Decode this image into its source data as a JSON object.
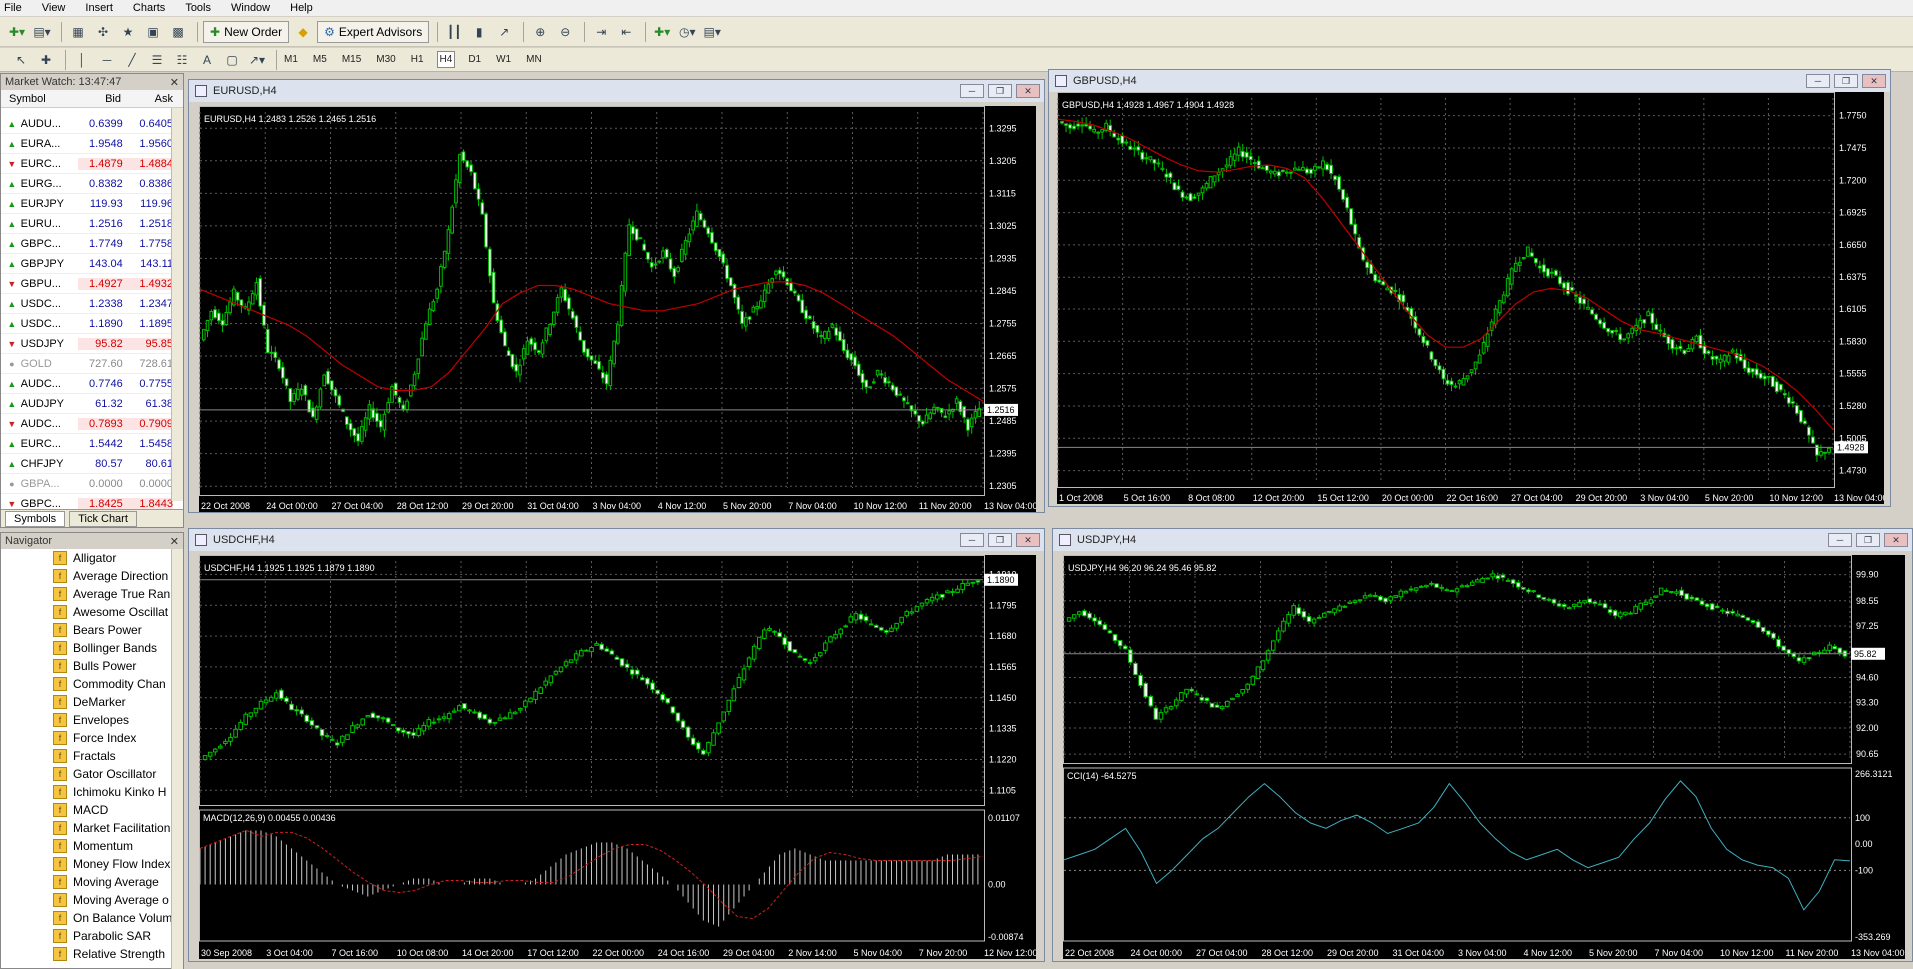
{
  "menu": [
    "File",
    "View",
    "Insert",
    "Charts",
    "Tools",
    "Window",
    "Help"
  ],
  "toolbar": {
    "new_order": "New Order",
    "expert_advisors": "Expert Advisors"
  },
  "timeframes": [
    "M1",
    "M5",
    "M15",
    "M30",
    "H1",
    "H4",
    "D1",
    "W1",
    "MN"
  ],
  "active_timeframe": "H4",
  "market_watch": {
    "title": "Market Watch: 13:47:47",
    "col_symbol": "Symbol",
    "col_bid": "Bid",
    "col_ask": "Ask",
    "rows": [
      {
        "sym": "AUDU...",
        "bid": "0.6399",
        "ask": "0.6405",
        "dir": "up"
      },
      {
        "sym": "EURA...",
        "bid": "1.9548",
        "ask": "1.9560",
        "dir": "up"
      },
      {
        "sym": "EURC...",
        "bid": "1.4879",
        "ask": "1.4884",
        "dir": "down"
      },
      {
        "sym": "EURG...",
        "bid": "0.8382",
        "ask": "0.8386",
        "dir": "up"
      },
      {
        "sym": "EURJPY",
        "bid": "119.93",
        "ask": "119.96",
        "dir": "up"
      },
      {
        "sym": "EURU...",
        "bid": "1.2516",
        "ask": "1.2518",
        "dir": "up"
      },
      {
        "sym": "GBPC...",
        "bid": "1.7749",
        "ask": "1.7758",
        "dir": "up"
      },
      {
        "sym": "GBPJPY",
        "bid": "143.04",
        "ask": "143.11",
        "dir": "up"
      },
      {
        "sym": "GBPU...",
        "bid": "1.4927",
        "ask": "1.4932",
        "dir": "down"
      },
      {
        "sym": "USDC...",
        "bid": "1.2338",
        "ask": "1.2347",
        "dir": "up"
      },
      {
        "sym": "USDC...",
        "bid": "1.1890",
        "ask": "1.1895",
        "dir": "up"
      },
      {
        "sym": "USDJPY",
        "bid": "95.82",
        "ask": "95.85",
        "dir": "down"
      },
      {
        "sym": "GOLD",
        "bid": "727.60",
        "ask": "728.61",
        "dir": "none"
      },
      {
        "sym": "AUDC...",
        "bid": "0.7746",
        "ask": "0.7755",
        "dir": "up"
      },
      {
        "sym": "AUDJPY",
        "bid": "61.32",
        "ask": "61.38",
        "dir": "up"
      },
      {
        "sym": "AUDC...",
        "bid": "0.7893",
        "ask": "0.7909",
        "dir": "down"
      },
      {
        "sym": "EURC...",
        "bid": "1.5442",
        "ask": "1.5458",
        "dir": "up"
      },
      {
        "sym": "CHFJPY",
        "bid": "80.57",
        "ask": "80.61",
        "dir": "up"
      },
      {
        "sym": "GBPA...",
        "bid": "0.0000",
        "ask": "0.0000",
        "dir": "none"
      },
      {
        "sym": "GBPC...",
        "bid": "1.8425",
        "ask": "1.8443",
        "dir": "down"
      }
    ],
    "tab_symbols": "Symbols",
    "tab_tick": "Tick Chart"
  },
  "navigator": {
    "title": "Navigator",
    "items": [
      "Alligator",
      "Average Direction",
      "Average True Ran",
      "Awesome Oscillat",
      "Bears Power",
      "Bollinger Bands",
      "Bulls Power",
      "Commodity Chan",
      "DeMarker",
      "Envelopes",
      "Force Index",
      "Fractals",
      "Gator Oscillator",
      "Ichimoku Kinko H",
      "MACD",
      "Market Facilitation",
      "Momentum",
      "Money Flow Index",
      "Moving Average",
      "Moving Average o",
      "On Balance Volum",
      "Parabolic SAR",
      "Relative Strength"
    ]
  },
  "charts": {
    "eurusd": {
      "title": "EURUSD,H4",
      "info": "EURUSD,H4  1.2483 1.2526 1.2465 1.2516",
      "yticks": [
        "1.3295",
        "1.3205",
        "1.3115",
        "1.3025",
        "1.2935",
        "1.2845",
        "1.2755",
        "1.2665",
        "1.2575",
        "1.2485",
        "1.2395",
        "1.2305"
      ],
      "xticks": [
        "22 Oct 2008",
        "24 Oct 00:00",
        "27 Oct 04:00",
        "28 Oct 12:00",
        "29 Oct 20:00",
        "31 Oct 04:00",
        "3 Nov 04:00",
        "4 Nov 12:00",
        "5 Nov 20:00",
        "7 Nov 04:00",
        "10 Nov 12:00",
        "11 Nov 20:00",
        "13 Nov 04:00"
      ],
      "price": "1.2516",
      "ymin": 1.23,
      "ymax": 1.334,
      "closes": [
        1.271,
        1.279,
        1.276,
        1.284,
        1.279,
        1.287,
        1.268,
        1.264,
        1.254,
        1.258,
        1.249,
        1.262,
        1.255,
        1.248,
        1.243,
        1.252,
        1.247,
        1.258,
        1.251,
        1.262,
        1.276,
        1.285,
        1.301,
        1.322,
        1.317,
        1.305,
        1.281,
        1.269,
        1.262,
        1.271,
        1.268,
        1.276,
        1.285,
        1.277,
        1.268,
        1.264,
        1.259,
        1.276,
        1.303,
        1.298,
        1.291,
        1.295,
        1.289,
        1.298,
        1.306,
        1.301,
        1.294,
        1.286,
        1.275,
        1.279,
        1.284,
        1.291,
        1.287,
        1.281,
        1.276,
        1.271,
        1.275,
        1.268,
        1.264,
        1.257,
        1.262,
        1.259,
        1.255,
        1.251,
        1.248,
        1.252,
        1.25,
        1.254,
        1.247,
        1.252
      ],
      "ma": [
        1.285,
        1.283,
        1.281,
        1.279,
        1.277,
        1.275,
        1.272,
        1.268,
        1.264,
        1.261,
        1.258,
        1.257,
        1.257,
        1.258,
        1.262,
        1.268,
        1.274,
        1.281,
        1.284,
        1.286,
        1.286,
        1.285,
        1.283,
        1.281,
        1.28,
        1.279,
        1.279,
        1.28,
        1.281,
        1.283,
        1.285,
        1.286,
        1.287,
        1.287,
        1.286,
        1.284,
        1.281,
        1.278,
        1.275,
        1.272,
        1.268,
        1.264,
        1.26,
        1.257,
        1.254
      ]
    },
    "gbpusd": {
      "title": "GBPUSD,H4",
      "info": "GBPUSD,H4  1.4928 1.4967 1.4904 1.4928",
      "yticks": [
        "1.7750",
        "1.7475",
        "1.7200",
        "1.6925",
        "1.6650",
        "1.6375",
        "1.6105",
        "1.5830",
        "1.5555",
        "1.5280",
        "1.5005",
        "1.4730"
      ],
      "xticks": [
        "1 Oct 2008",
        "5 Oct 16:00",
        "8 Oct 08:00",
        "12 Oct 20:00",
        "15 Oct 12:00",
        "20 Oct 00:00",
        "22 Oct 16:00",
        "27 Oct 04:00",
        "29 Oct 20:00",
        "3 Nov 04:00",
        "5 Nov 20:00",
        "10 Nov 12:00",
        "13 Nov 04:00"
      ],
      "price": "1.4928",
      "ymin": 1.465,
      "ymax": 1.79,
      "closes": [
        1.77,
        1.765,
        1.77,
        1.76,
        1.766,
        1.755,
        1.748,
        1.741,
        1.735,
        1.725,
        1.71,
        1.705,
        1.712,
        1.725,
        1.733,
        1.745,
        1.738,
        1.73,
        1.725,
        1.728,
        1.731,
        1.726,
        1.735,
        1.72,
        1.695,
        1.66,
        1.64,
        1.63,
        1.625,
        1.61,
        1.59,
        1.57,
        1.55,
        1.545,
        1.555,
        1.57,
        1.6,
        1.625,
        1.65,
        1.66,
        1.645,
        1.64,
        1.63,
        1.62,
        1.61,
        1.6,
        1.59,
        1.585,
        1.595,
        1.605,
        1.59,
        1.58,
        1.575,
        1.585,
        1.57,
        1.565,
        1.575,
        1.56,
        1.555,
        1.55,
        1.54,
        1.53,
        1.51,
        1.485,
        1.493
      ],
      "ma": [
        1.772,
        1.77,
        1.767,
        1.762,
        1.756,
        1.748,
        1.74,
        1.733,
        1.728,
        1.727,
        1.729,
        1.732,
        1.733,
        1.73,
        1.722,
        1.705,
        1.685,
        1.665,
        1.645,
        1.625,
        1.605,
        1.588,
        1.578,
        1.578,
        1.585,
        1.6,
        1.615,
        1.625,
        1.628,
        1.626,
        1.62,
        1.61,
        1.6,
        1.593,
        1.59,
        1.586,
        1.582,
        1.578,
        1.574,
        1.569,
        1.562,
        1.552,
        1.54,
        1.525,
        1.508
      ]
    },
    "usdchf": {
      "title": "USDCHF,H4",
      "info": "USDCHF,H4  1.1925 1.1925 1.1879 1.1890",
      "yticks": [
        "1.1910",
        "1.1795",
        "1.1680",
        "1.1565",
        "1.1450",
        "1.1335",
        "1.1220",
        "1.1105"
      ],
      "xticks": [
        "30 Sep 2008",
        "3 Oct 04:00",
        "7 Oct 16:00",
        "10 Oct 08:00",
        "14 Oct 20:00",
        "17 Oct 12:00",
        "22 Oct 00:00",
        "24 Oct 16:00",
        "29 Oct 04:00",
        "2 Nov 14:00",
        "5 Nov 04:00",
        "7 Nov 20:00",
        "12 Nov 12:00"
      ],
      "price": "1.1890",
      "ymin": 1.108,
      "ymax": 1.196,
      "closes": [
        1.122,
        1.126,
        1.131,
        1.138,
        1.143,
        1.147,
        1.141,
        1.137,
        1.131,
        1.128,
        1.134,
        1.139,
        1.137,
        1.133,
        1.131,
        1.136,
        1.138,
        1.142,
        1.139,
        1.136,
        1.138,
        1.141,
        1.147,
        1.153,
        1.158,
        1.162,
        1.165,
        1.161,
        1.156,
        1.152,
        1.147,
        1.14,
        1.13,
        1.124,
        1.136,
        1.148,
        1.16,
        1.171,
        1.168,
        1.161,
        1.158,
        1.165,
        1.171,
        1.176,
        1.172,
        1.17,
        1.175,
        1.179,
        1.182,
        1.184,
        1.187,
        1.189
      ],
      "macd_title": "MACD(12,26,9) 0.00455 0.00436",
      "macd_ticks": [
        "0.01107",
        "0.00",
        "-0.00874"
      ],
      "macd": [
        0.006,
        0.007,
        0.008,
        0.009,
        0.009,
        0.008,
        0.006,
        0.004,
        0.002,
        0.0,
        -0.001,
        -0.002,
        -0.001,
        0.0,
        0.001,
        0.001,
        0.0,
        0.0,
        0.001,
        0.001,
        0.0,
        0.0,
        0.001,
        0.003,
        0.005,
        0.006,
        0.007,
        0.007,
        0.006,
        0.004,
        0.002,
        0.0,
        -0.003,
        -0.006,
        -0.007,
        -0.004,
        -0.001,
        0.002,
        0.005,
        0.006,
        0.005,
        0.004,
        0.004,
        0.004,
        0.004,
        0.004,
        0.004,
        0.004,
        0.004,
        0.005,
        0.005,
        0.005
      ]
    },
    "usdjpy": {
      "title": "USDJPY,H4",
      "info": "USDJPY,H4  96.20 96.24 95.46 95.82",
      "yticks": [
        "99.90",
        "98.55",
        "97.25",
        "95.90",
        "94.60",
        "93.30",
        "92.00",
        "90.65"
      ],
      "xticks": [
        "22 Oct 2008",
        "24 Oct 00:00",
        "27 Oct 04:00",
        "28 Oct 12:00",
        "29 Oct 20:00",
        "31 Oct 04:00",
        "3 Nov 04:00",
        "4 Nov 12:00",
        "5 Nov 20:00",
        "7 Nov 04:00",
        "10 Nov 12:00",
        "11 Nov 20:00",
        "13 Nov 04:00"
      ],
      "price": "95.82",
      "ymin": 90.4,
      "ymax": 100.6,
      "closes": [
        97.5,
        98.0,
        97.6,
        96.8,
        96.0,
        94.2,
        92.5,
        93.2,
        94.0,
        93.5,
        93.0,
        93.6,
        94.2,
        95.5,
        97.0,
        98.2,
        97.5,
        97.9,
        98.2,
        98.6,
        98.9,
        98.5,
        99.0,
        99.2,
        99.4,
        99.0,
        99.3,
        99.6,
        99.9,
        99.6,
        99.2,
        98.8,
        98.4,
        98.2,
        98.6,
        98.3,
        97.8,
        98.0,
        98.5,
        99.1,
        99.0,
        98.6,
        98.3,
        98.0,
        97.8,
        97.5,
        96.8,
        96.0,
        95.4,
        95.8,
        96.2,
        95.8
      ],
      "cci_title": "CCI(14) -64.5275",
      "cci_ticks": [
        "266.3121",
        "100",
        "0.00",
        "-100",
        "-353.269"
      ],
      "cci": [
        -60,
        -40,
        -20,
        20,
        60,
        -30,
        -150,
        -100,
        -40,
        20,
        60,
        120,
        180,
        230,
        180,
        120,
        80,
        60,
        90,
        110,
        80,
        40,
        60,
        80,
        140,
        230,
        160,
        80,
        20,
        -30,
        -60,
        -40,
        -20,
        -60,
        -90,
        -70,
        -50,
        20,
        80,
        170,
        240,
        180,
        60,
        -20,
        -60,
        -80,
        -90,
        -130,
        -250,
        -180,
        -60,
        -64
      ]
    }
  }
}
